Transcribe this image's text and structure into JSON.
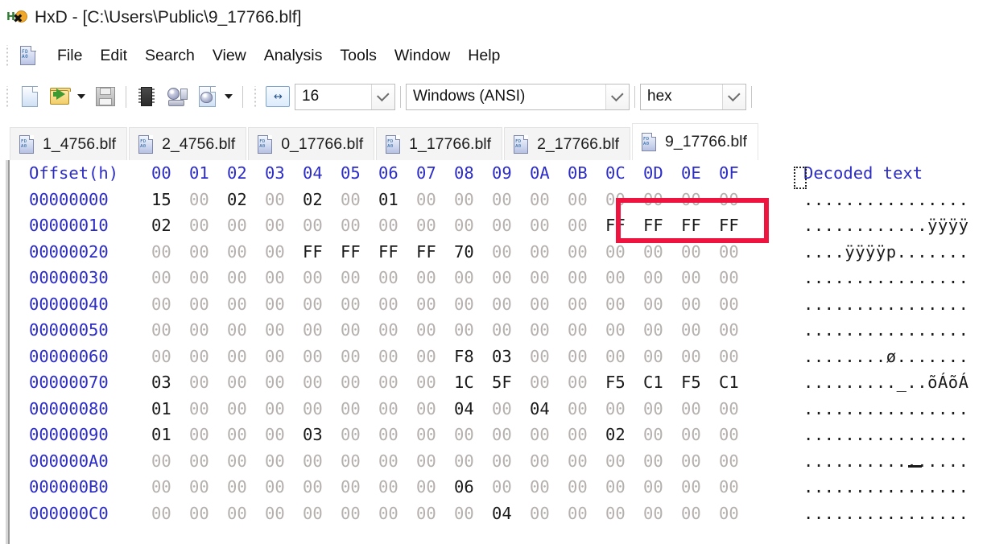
{
  "window": {
    "title": "HxD - [C:\\Users\\Public\\9_17766.blf]",
    "app_icon": "hxd-logo-icon",
    "app_icon_text": "Hx"
  },
  "menubar": {
    "doc_icon": "hex-document-icon",
    "items": [
      {
        "label": "File"
      },
      {
        "label": "Edit"
      },
      {
        "label": "Search"
      },
      {
        "label": "View"
      },
      {
        "label": "Analysis"
      },
      {
        "label": "Tools"
      },
      {
        "label": "Window"
      },
      {
        "label": "Help"
      }
    ]
  },
  "toolbar": {
    "buttons": [
      {
        "name": "new-file-icon",
        "tooltip": "New"
      },
      {
        "name": "open-file-icon",
        "tooltip": "Open"
      },
      {
        "name": "open-dropdown-caret-icon",
        "tooltip": "Open recent"
      },
      {
        "name": "save-icon",
        "tooltip": "Save"
      },
      {
        "name": "open-ram-icon",
        "tooltip": "Open RAM"
      },
      {
        "name": "open-disk-icon",
        "tooltip": "Open disk"
      },
      {
        "name": "open-disk-image-icon",
        "tooltip": "Open disk image"
      },
      {
        "name": "disk-dropdown-caret-icon",
        "tooltip": "More"
      }
    ],
    "bytes_per_row": {
      "icon": "bytes-per-row-icon",
      "value": "16"
    },
    "encoding": {
      "value": "Windows (ANSI)"
    },
    "offset_base": {
      "value": "hex"
    }
  },
  "tabs": [
    {
      "label": "1_4756.blf",
      "active": false
    },
    {
      "label": "2_4756.blf",
      "active": false
    },
    {
      "label": "0_17766.blf",
      "active": false
    },
    {
      "label": "1_17766.blf",
      "active": false
    },
    {
      "label": "2_17766.blf",
      "active": false
    },
    {
      "label": "9_17766.blf",
      "active": true
    }
  ],
  "hex_view": {
    "header": {
      "offset_label": "Offset(h)",
      "columns": [
        "00",
        "01",
        "02",
        "03",
        "04",
        "05",
        "06",
        "07",
        "08",
        "09",
        "0A",
        "0B",
        "0C",
        "0D",
        "0E",
        "0F"
      ],
      "text_label": "Decoded text"
    },
    "rows": [
      {
        "offset": "00000000",
        "bytes": [
          "15",
          "00",
          "02",
          "00",
          "02",
          "00",
          "01",
          "00",
          "00",
          "00",
          "00",
          "00",
          "00",
          "00",
          "00",
          "00"
        ],
        "text": "................"
      },
      {
        "offset": "00000010",
        "bytes": [
          "02",
          "00",
          "00",
          "00",
          "00",
          "00",
          "00",
          "00",
          "00",
          "00",
          "00",
          "00",
          "FF",
          "FF",
          "FF",
          "FF"
        ],
        "text": "............ÿÿÿÿ"
      },
      {
        "offset": "00000020",
        "bytes": [
          "00",
          "00",
          "00",
          "00",
          "FF",
          "FF",
          "FF",
          "FF",
          "70",
          "00",
          "00",
          "00",
          "00",
          "00",
          "00",
          "00"
        ],
        "text": "....ÿÿÿÿp......."
      },
      {
        "offset": "00000030",
        "bytes": [
          "00",
          "00",
          "00",
          "00",
          "00",
          "00",
          "00",
          "00",
          "00",
          "00",
          "00",
          "00",
          "00",
          "00",
          "00",
          "00"
        ],
        "text": "................"
      },
      {
        "offset": "00000040",
        "bytes": [
          "00",
          "00",
          "00",
          "00",
          "00",
          "00",
          "00",
          "00",
          "00",
          "00",
          "00",
          "00",
          "00",
          "00",
          "00",
          "00"
        ],
        "text": "................"
      },
      {
        "offset": "00000050",
        "bytes": [
          "00",
          "00",
          "00",
          "00",
          "00",
          "00",
          "00",
          "00",
          "00",
          "00",
          "00",
          "00",
          "00",
          "00",
          "00",
          "00"
        ],
        "text": "................"
      },
      {
        "offset": "00000060",
        "bytes": [
          "00",
          "00",
          "00",
          "00",
          "00",
          "00",
          "00",
          "00",
          "F8",
          "03",
          "00",
          "00",
          "00",
          "00",
          "00",
          "00"
        ],
        "text": "........ø......."
      },
      {
        "offset": "00000070",
        "bytes": [
          "03",
          "00",
          "00",
          "00",
          "00",
          "00",
          "00",
          "00",
          "1C",
          "5F",
          "00",
          "00",
          "F5",
          "C1",
          "F5",
          "C1"
        ],
        "text": "........._..õÁõÁ"
      },
      {
        "offset": "00000080",
        "bytes": [
          "01",
          "00",
          "00",
          "00",
          "00",
          "00",
          "00",
          "00",
          "04",
          "00",
          "04",
          "00",
          "00",
          "00",
          "00",
          "00"
        ],
        "text": "................"
      },
      {
        "offset": "00000090",
        "bytes": [
          "01",
          "00",
          "00",
          "00",
          "03",
          "00",
          "00",
          "00",
          "00",
          "00",
          "00",
          "00",
          "02",
          "00",
          "00",
          "00"
        ],
        "text": "................"
      },
      {
        "offset": "000000A0",
        "bytes": [
          "00",
          "00",
          "00",
          "00",
          "00",
          "00",
          "00",
          "00",
          "00",
          "00",
          "00",
          "00",
          "00",
          "00",
          "00",
          "00"
        ],
        "text": "................"
      },
      {
        "offset": "000000B0",
        "bytes": [
          "00",
          "00",
          "00",
          "00",
          "00",
          "00",
          "00",
          "00",
          "06",
          "00",
          "00",
          "00",
          "00",
          "00",
          "00",
          "00"
        ],
        "text": "................"
      },
      {
        "offset": "000000C0",
        "bytes": [
          "00",
          "00",
          "00",
          "00",
          "00",
          "00",
          "00",
          "00",
          "00",
          "04",
          "00",
          "00",
          "00",
          "00",
          "00",
          "00"
        ],
        "text": "................"
      }
    ]
  },
  "annotation": {
    "name": "red-highlight-rectangle",
    "color": "#EF143F",
    "covers_columns": [
      "0C",
      "0D",
      "0E",
      "0F"
    ],
    "covers_row_offset": "00000000"
  },
  "colors": {
    "offset_text": "#2B2BC6",
    "header_text": "#2C2CC8",
    "byte_nonzero": "#1A1A1A",
    "byte_zero": "#B5B0AE",
    "annotation": "#EF143F"
  }
}
